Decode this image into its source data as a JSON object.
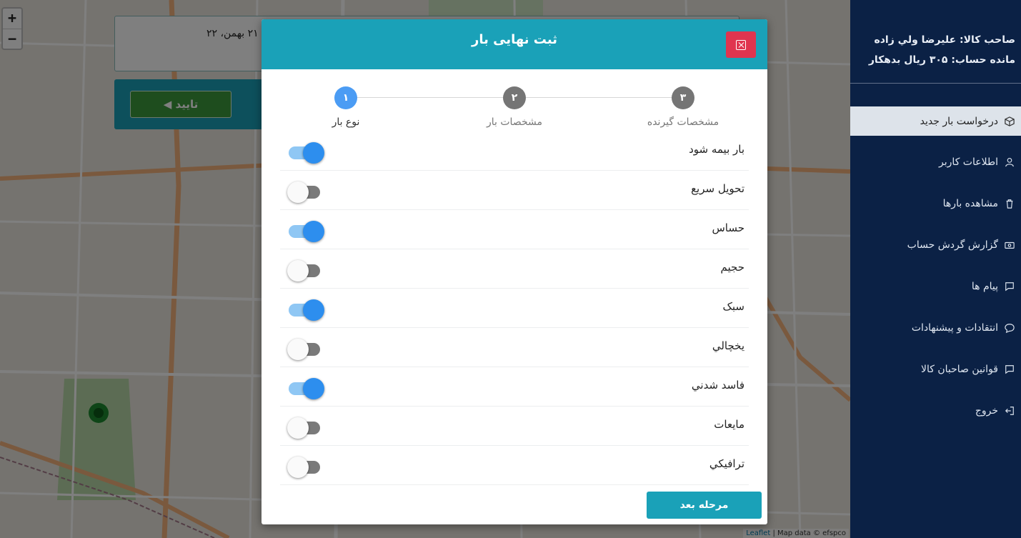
{
  "map": {
    "zoom_in": "+",
    "zoom_out": "−",
    "attribution_leaflet": "Leaflet",
    "attribution_rest": "| Map data © efspco"
  },
  "background_page": {
    "date_text": "۲۱ بهمن، ۲۲",
    "confirm_label": "تایید",
    "confirm_icon": "triangle-left-icon"
  },
  "sidebar": {
    "owner_line": "صاحب کالا: علیرضا ولي زاده",
    "balance_line": "مانده حساب: ۳۰۵ ريال بدهکار",
    "items": [
      {
        "label": "درخواست بار جدید",
        "icon": "box-icon"
      },
      {
        "label": "اطلاعات کاربر",
        "icon": "user-icon"
      },
      {
        "label": "مشاهده بارها",
        "icon": "trash-icon"
      },
      {
        "label": "گزارش گردش حساب",
        "icon": "money-icon"
      },
      {
        "label": "پیام ها",
        "icon": "message-icon"
      },
      {
        "label": "انتقادات و پیشنهادات",
        "icon": "chat-icon"
      },
      {
        "label": "قوانین صاحبان کالا",
        "icon": "message-icon"
      },
      {
        "label": "خروج",
        "icon": "logout-icon"
      }
    ]
  },
  "modal": {
    "title": "ثبت نهایی بار",
    "steps": [
      {
        "number": "۱",
        "label": "نوع بار",
        "active": true
      },
      {
        "number": "۲",
        "label": "مشخصات بار",
        "active": false
      },
      {
        "number": "۳",
        "label": "مشخصات گیرنده",
        "active": false
      }
    ],
    "options": [
      {
        "label": "بار بیمه شود",
        "on": true
      },
      {
        "label": "تحویل سریع",
        "on": false
      },
      {
        "label": "حساس",
        "on": true
      },
      {
        "label": "حجیم",
        "on": false
      },
      {
        "label": "سبک",
        "on": true
      },
      {
        "label": "يخچالي",
        "on": false
      },
      {
        "label": "فاسد شدني",
        "on": true
      },
      {
        "label": "مايعات",
        "on": false
      },
      {
        "label": "ترافيكي",
        "on": false
      }
    ],
    "next_label": "مرحله بعد"
  },
  "colors": {
    "primary": "#1aa1b8",
    "sidebar_bg": "#0b2145",
    "close_red": "#e0344f",
    "switch_on": "#2d8eee",
    "step_active": "#4b9cf4"
  }
}
